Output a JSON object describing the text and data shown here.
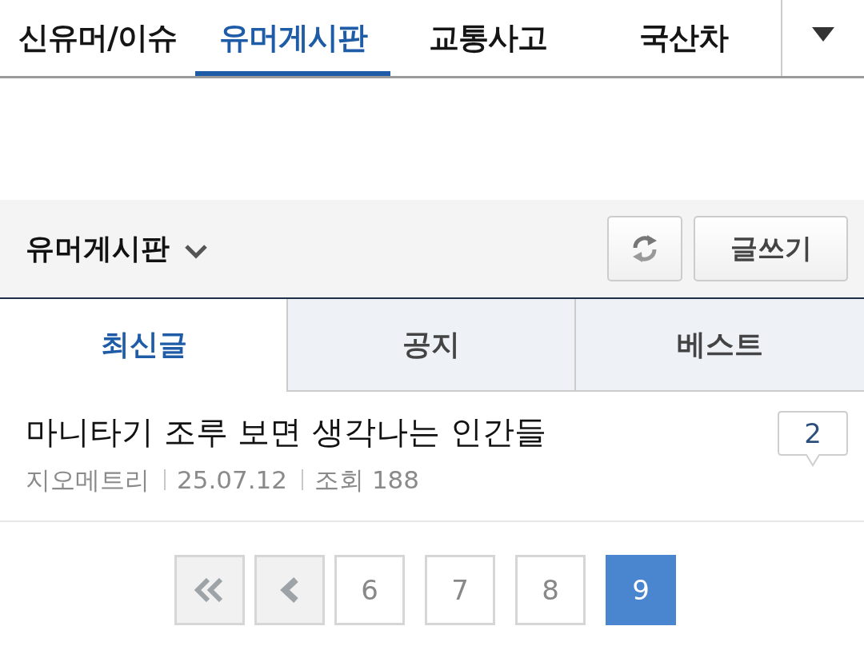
{
  "top_tabs": [
    {
      "label": "신유머/이슈",
      "selected": false
    },
    {
      "label": "유머게시판",
      "selected": true
    },
    {
      "label": "교통사고",
      "selected": false
    },
    {
      "label": "국산차",
      "selected": false
    }
  ],
  "board_header": {
    "title": "유머게시판",
    "write_button": "글쓰기"
  },
  "sub_tabs": [
    {
      "label": "최신글",
      "selected": true
    },
    {
      "label": "공지",
      "selected": false
    },
    {
      "label": "베스트",
      "selected": false
    }
  ],
  "posts": [
    {
      "title": "마니타기 조루 보면 생각나는 인간들",
      "author": "지오메트리",
      "date": "25.07.12",
      "views": "조회 188",
      "comments": "2"
    }
  ],
  "pagination": {
    "pages": [
      {
        "label": "6",
        "selected": false
      },
      {
        "label": "7",
        "selected": false
      },
      {
        "label": "8",
        "selected": false
      },
      {
        "label": "9",
        "selected": true
      }
    ]
  }
}
